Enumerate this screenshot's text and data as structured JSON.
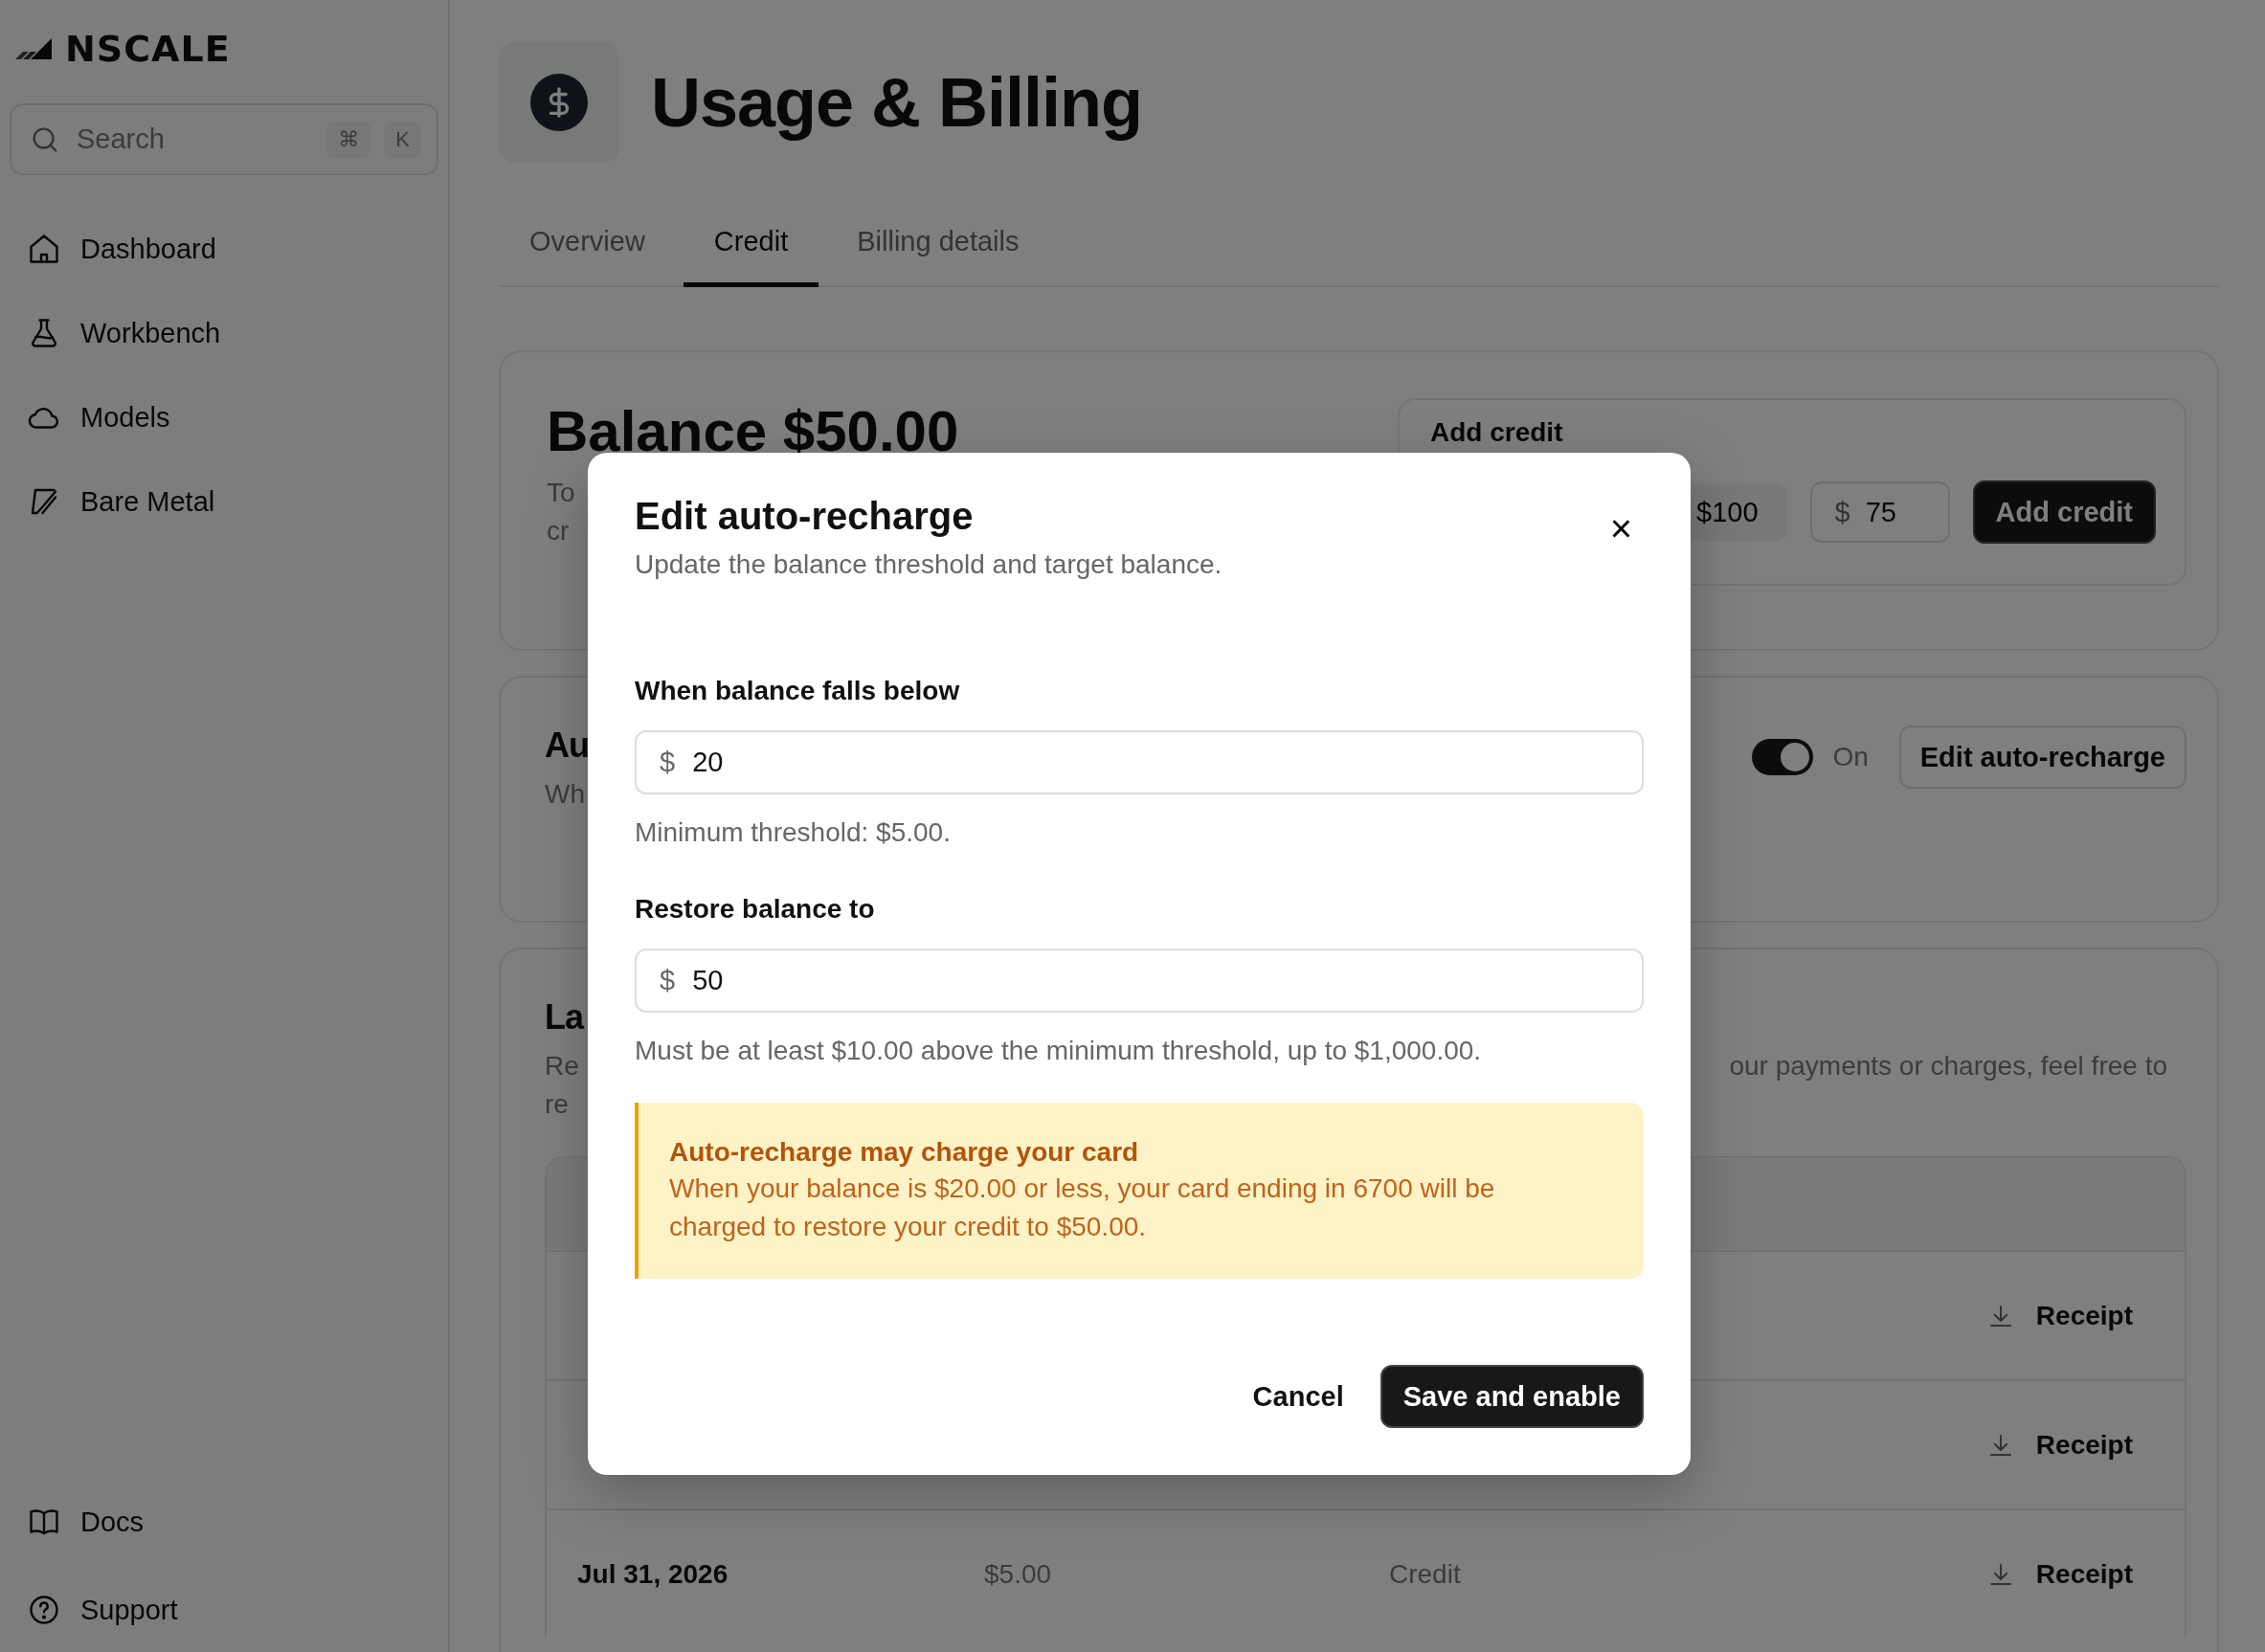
{
  "sidebar": {
    "logo": "NSCALE",
    "search": {
      "placeholder": "Search",
      "keys": [
        "⌘",
        "K"
      ]
    },
    "nav_items": [
      {
        "label": "Dashboard"
      },
      {
        "label": "Workbench"
      },
      {
        "label": "Models"
      },
      {
        "label": "Bare Metal"
      }
    ],
    "footer_items": [
      {
        "label": "Docs"
      },
      {
        "label": "Support"
      }
    ]
  },
  "header": {
    "title": "Usage & Billing"
  },
  "tabs": [
    {
      "label": "Overview",
      "selected": false
    },
    {
      "label": "Credit",
      "selected": true
    },
    {
      "label": "Billing details",
      "selected": false
    }
  ],
  "balance_card": {
    "title": "Balance $50.00",
    "description": [
      "To",
      "cr"
    ],
    "add_credit": {
      "label": "Add credit",
      "preset": "$100",
      "amount": {
        "prefix": "$",
        "value": "75"
      },
      "button": "Add credit"
    }
  },
  "auto_recharge_card": {
    "title": "Au",
    "description": "Wh",
    "toggle": {
      "on": true,
      "label": "On"
    },
    "button": "Edit auto-recharge"
  },
  "transactions_card": {
    "title": "La",
    "description_left": [
      "Re",
      "re"
    ],
    "description_right": "our payments or charges, feel free to",
    "table": {
      "rows": [
        {
          "receipt": "Receipt"
        },
        {
          "receipt": "Receipt"
        },
        {
          "cells": [
            "Jul 31, 2026",
            "$5.00",
            "Credit"
          ],
          "receipt": "Receipt"
        }
      ]
    }
  },
  "modal": {
    "title": "Edit auto-recharge",
    "subtitle": "Update the balance threshold and target balance.",
    "close": "×",
    "fields": [
      {
        "label": "When balance falls below",
        "prefix": "$",
        "value": "20",
        "hint": "Minimum threshold: $5.00."
      },
      {
        "label": "Restore balance to",
        "prefix": "$",
        "value": "50",
        "hint": "Must be at least $10.00 above the minimum threshold, up to $1,000.00."
      }
    ],
    "warning": {
      "title": "Auto-recharge may charge your card",
      "body": "When your balance is $20.00 or less, your card ending in 6700 will be charged to restore your credit to $50.00."
    },
    "buttons": [
      {
        "label": "Cancel",
        "kind": "secondary"
      },
      {
        "label": "Save and enable",
        "kind": "primary"
      }
    ]
  }
}
